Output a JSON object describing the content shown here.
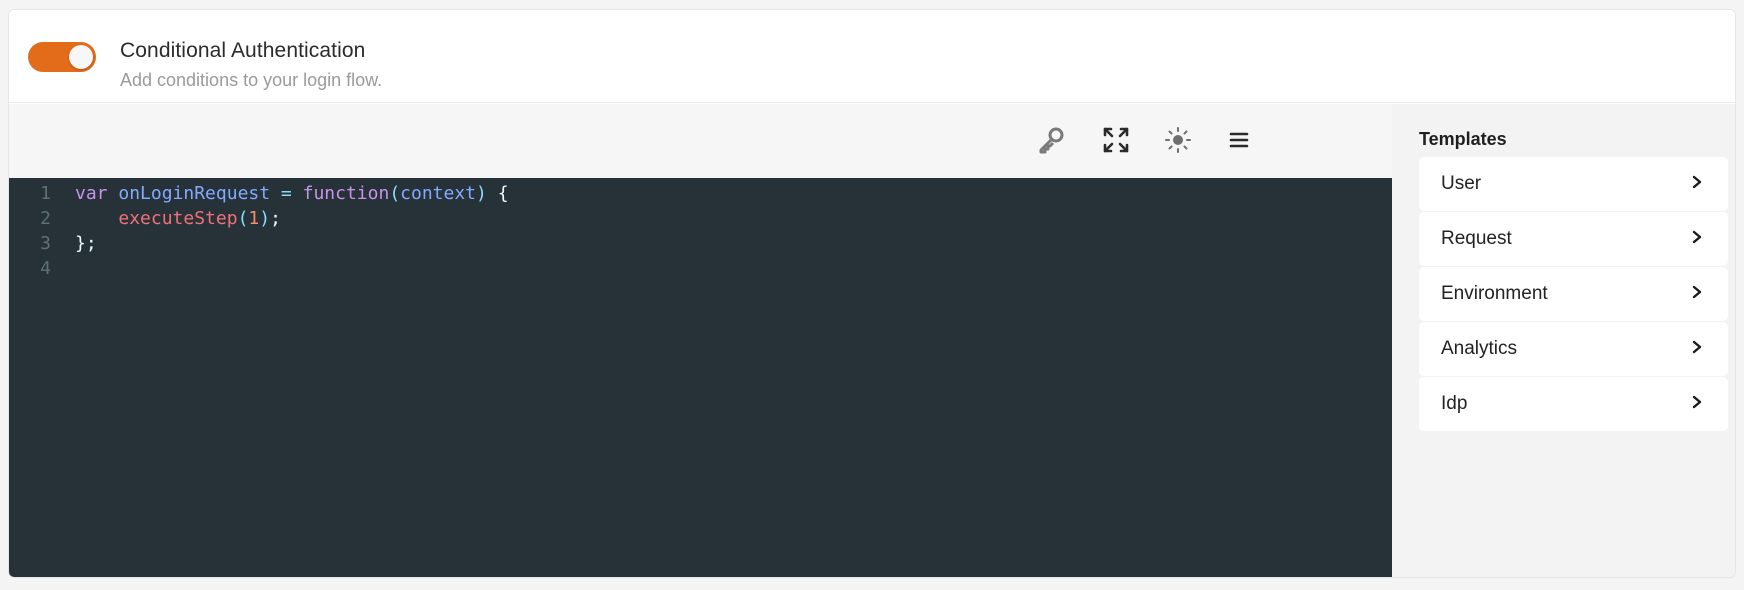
{
  "header": {
    "title": "Conditional Authentication",
    "subtitle": "Add conditions to your login flow.",
    "toggle_on": true,
    "toggle_color": "#e26c1a"
  },
  "toolbar": {
    "icons": [
      "key-icon",
      "fullscreen-icon",
      "theme-sun-icon",
      "menu-icon"
    ]
  },
  "editor": {
    "background": "#263238",
    "line_numbers": [
      "1",
      "2",
      "3",
      "4"
    ],
    "lines": [
      {
        "tokens": [
          {
            "t": "var",
            "c": "kw"
          },
          {
            "t": " ",
            "c": "txt"
          },
          {
            "t": "onLoginRequest",
            "c": "fn"
          },
          {
            "t": " ",
            "c": "txt"
          },
          {
            "t": "=",
            "c": "op"
          },
          {
            "t": " ",
            "c": "txt"
          },
          {
            "t": "function",
            "c": "kw"
          },
          {
            "t": "(",
            "c": "op"
          },
          {
            "t": "context",
            "c": "fn"
          },
          {
            "t": ")",
            "c": "op"
          },
          {
            "t": " {",
            "c": "txt"
          }
        ]
      },
      {
        "tokens": [
          {
            "t": "    ",
            "c": "txt"
          },
          {
            "t": "executeStep",
            "c": "err"
          },
          {
            "t": "(",
            "c": "op"
          },
          {
            "t": "1",
            "c": "num"
          },
          {
            "t": ")",
            "c": "op"
          },
          {
            "t": ";",
            "c": "txt"
          }
        ]
      },
      {
        "tokens": [
          {
            "t": "};",
            "c": "txt"
          }
        ]
      },
      {
        "tokens": []
      }
    ]
  },
  "templates": {
    "title": "Templates",
    "items": [
      {
        "label": "User"
      },
      {
        "label": "Request"
      },
      {
        "label": "Environment"
      },
      {
        "label": "Analytics"
      },
      {
        "label": "Idp"
      }
    ]
  }
}
